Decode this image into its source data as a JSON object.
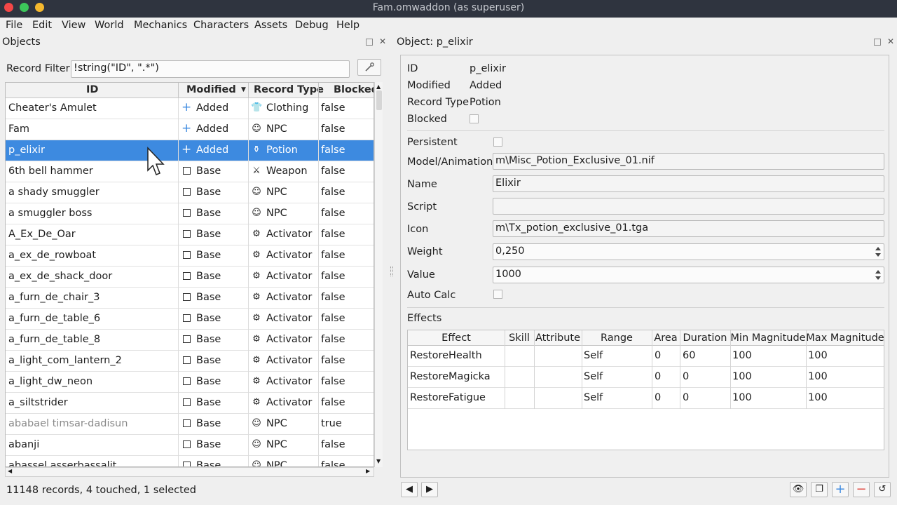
{
  "window": {
    "title": "Fam.omwaddon (as superuser)"
  },
  "menu": [
    "File",
    "Edit",
    "View",
    "World",
    "Mechanics",
    "Characters",
    "Assets",
    "Debug",
    "Help"
  ],
  "objects_panel": {
    "title": "Objects",
    "filter_label": "Record Filter",
    "filter_value": "!string(\"ID\", \".*\")",
    "columns": [
      "ID",
      "Modified",
      "Record Type",
      "Blocked"
    ],
    "rows": [
      {
        "id": "Cheater's Amulet",
        "modified": "Added",
        "type": "Clothing",
        "blocked": "false",
        "mod_icon": "plus-icon",
        "type_icon": "shirt-icon"
      },
      {
        "id": "Fam",
        "modified": "Added",
        "type": "NPC",
        "blocked": "false",
        "mod_icon": "plus-icon",
        "type_icon": "head-icon"
      },
      {
        "id": "p_elixir",
        "modified": "Added",
        "type": "Potion",
        "blocked": "false",
        "mod_icon": "plus-icon",
        "type_icon": "potion-icon",
        "selected": true
      },
      {
        "id": "6th bell hammer",
        "modified": "Base",
        "type": "Weapon",
        "blocked": "false",
        "mod_icon": "square-icon",
        "type_icon": "sword-icon"
      },
      {
        "id": "a shady smuggler",
        "modified": "Base",
        "type": "NPC",
        "blocked": "false",
        "mod_icon": "square-icon",
        "type_icon": "head-icon"
      },
      {
        "id": "a smuggler boss",
        "modified": "Base",
        "type": "NPC",
        "blocked": "false",
        "mod_icon": "square-icon",
        "type_icon": "head-icon"
      },
      {
        "id": "A_Ex_De_Oar",
        "modified": "Base",
        "type": "Activator",
        "blocked": "false",
        "mod_icon": "square-icon",
        "type_icon": "gear-icon"
      },
      {
        "id": "a_ex_de_rowboat",
        "modified": "Base",
        "type": "Activator",
        "blocked": "false",
        "mod_icon": "square-icon",
        "type_icon": "gear-icon"
      },
      {
        "id": "a_ex_de_shack_door",
        "modified": "Base",
        "type": "Activator",
        "blocked": "false",
        "mod_icon": "square-icon",
        "type_icon": "gear-icon"
      },
      {
        "id": "a_furn_de_chair_3",
        "modified": "Base",
        "type": "Activator",
        "blocked": "false",
        "mod_icon": "square-icon",
        "type_icon": "gear-icon"
      },
      {
        "id": "a_furn_de_table_6",
        "modified": "Base",
        "type": "Activator",
        "blocked": "false",
        "mod_icon": "square-icon",
        "type_icon": "gear-icon"
      },
      {
        "id": "a_furn_de_table_8",
        "modified": "Base",
        "type": "Activator",
        "blocked": "false",
        "mod_icon": "square-icon",
        "type_icon": "gear-icon"
      },
      {
        "id": "a_light_com_lantern_2",
        "modified": "Base",
        "type": "Activator",
        "blocked": "false",
        "mod_icon": "square-icon",
        "type_icon": "gear-icon"
      },
      {
        "id": "a_light_dw_neon",
        "modified": "Base",
        "type": "Activator",
        "blocked": "false",
        "mod_icon": "square-icon",
        "type_icon": "gear-icon"
      },
      {
        "id": "a_siltstrider",
        "modified": "Base",
        "type": "Activator",
        "blocked": "false",
        "mod_icon": "square-icon",
        "type_icon": "gear-icon"
      },
      {
        "id": "ababael timsar-dadisun",
        "modified": "Base",
        "type": "NPC",
        "blocked": "true",
        "mod_icon": "square-icon",
        "type_icon": "head-icon",
        "dimmed": true
      },
      {
        "id": "abanji",
        "modified": "Base",
        "type": "NPC",
        "blocked": "false",
        "mod_icon": "square-icon",
        "type_icon": "head-icon"
      },
      {
        "id": "abassel asserbassalit",
        "modified": "Base",
        "type": "NPC",
        "blocked": "false",
        "mod_icon": "square-icon",
        "type_icon": "head-icon"
      }
    ],
    "status": "11148 records, 4 touched, 1 selected"
  },
  "object_panel": {
    "title": "Object: p_elixir",
    "id_label": "ID",
    "id_value": "p_elixir",
    "modified_label": "Modified",
    "modified_value": "Added",
    "type_label": "Record Type",
    "type_value": "Potion",
    "blocked_label": "Blocked",
    "persistent_label": "Persistent",
    "model_label": "Model/Animation",
    "model_value": "m\\Misc_Potion_Exclusive_01.nif",
    "name_label": "Name",
    "name_value": "Elixir",
    "script_label": "Script",
    "script_value": "",
    "icon_label": "Icon",
    "icon_value": "m\\Tx_potion_exclusive_01.tga",
    "weight_label": "Weight",
    "weight_value": "0,250",
    "value_label": "Value",
    "value_value": "1000",
    "autocalc_label": "Auto Calc",
    "effects_label": "Effects",
    "effect_columns": [
      "Effect",
      "Skill",
      "Attribute",
      "Range",
      "Area",
      "Duration",
      "Min Magnitude",
      "Max Magnitude"
    ],
    "effects": [
      {
        "effect": "RestoreHealth",
        "skill": "",
        "attribute": "",
        "range": "Self",
        "area": "0",
        "duration": "60",
        "min": "100",
        "max": "100"
      },
      {
        "effect": "RestoreMagicka",
        "skill": "",
        "attribute": "",
        "range": "Self",
        "area": "0",
        "duration": "0",
        "min": "100",
        "max": "100"
      },
      {
        "effect": "RestoreFatigue",
        "skill": "",
        "attribute": "",
        "range": "Self",
        "area": "0",
        "duration": "0",
        "min": "100",
        "max": "100"
      }
    ]
  },
  "colors": {
    "selection": "#3d8ae0",
    "titlebar": "#2f343f",
    "close": "#f44747",
    "minimize": "#3cc55a",
    "maximize": "#f5b82e"
  }
}
